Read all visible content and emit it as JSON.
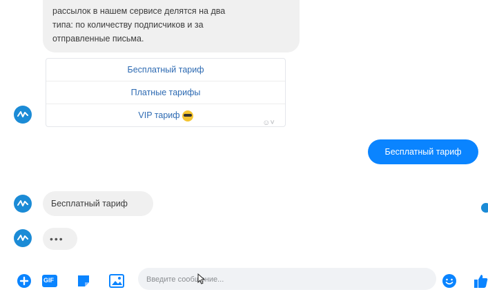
{
  "conversation": {
    "bot_message": "рассылок в нашем сервисе делятся на два\nтипа: по количеству подписчиков и за\nотправленные письма.",
    "quick_replies": [
      {
        "label": "Бесплатный тариф"
      },
      {
        "label": "Платные тарифы"
      },
      {
        "label": "VIP тариф"
      }
    ],
    "vip_emoji": "sunglasses-emoji",
    "user_message": "Бесплатный тариф",
    "bot_reply": "Бесплатный тариф",
    "typing_indicator": "•••"
  },
  "composer": {
    "placeholder": "Введите сообщение...",
    "gif_label": "GIF"
  },
  "icons": {
    "avatar": "bot-avatar-icon",
    "add": "plus-circle-icon",
    "gif": "gif-icon",
    "sticker": "sticker-icon",
    "image": "image-icon",
    "emoji": "emoji-icon",
    "like": "thumbs-up-icon"
  },
  "colors": {
    "accent": "#0a84ff",
    "avatar": "#1b8bd6",
    "bubble_gray": "#f0f0f0",
    "quick_reply_text": "#2d6ab2"
  }
}
